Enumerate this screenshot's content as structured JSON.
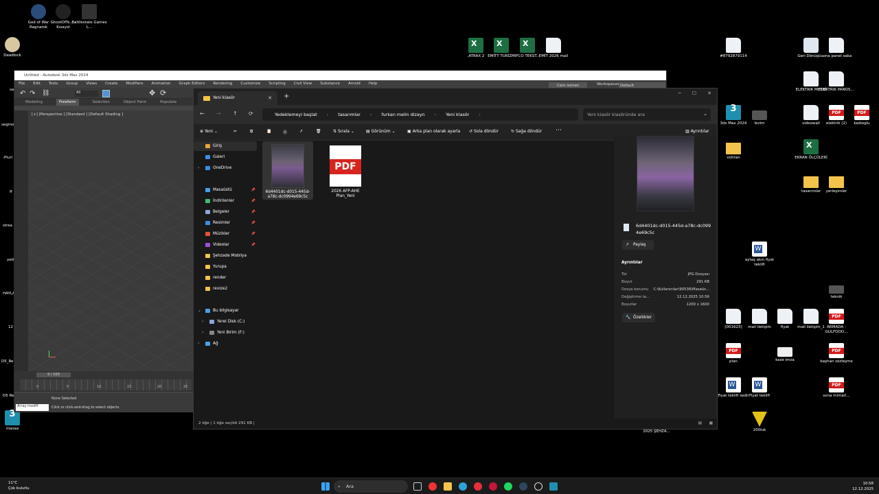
{
  "desktop": {
    "top_icons": [
      {
        "label": "God of War Ragnarok",
        "kind": "game"
      },
      {
        "label": "GhostOfTs... - Kısayol",
        "kind": "game"
      },
      {
        "label": "Battlestate Games L...",
        "kind": "game"
      },
      {
        "label": "Deadlock",
        "kind": "game"
      }
    ],
    "center_icons": [
      {
        "label": ",ATRAX 2",
        "kind": "xls"
      },
      {
        "label": "EMİTT TURİZM",
        "kind": "xls"
      },
      {
        "label": "IFCO TEKST...",
        "kind": "xls"
      },
      {
        "label": "EMİT 2026 mail",
        "kind": "doc"
      }
    ],
    "right_icons": [
      {
        "label": "#8792879114",
        "kind": "doc"
      },
      {
        "label": "Geri Dönüşü...",
        "kind": "recycle"
      },
      {
        "label": "sona panel saka",
        "kind": "doc"
      },
      {
        "label": "ELEKTRIK METNİ",
        "kind": "doc"
      },
      {
        "label": "ELEKTRIK PANOS...",
        "kind": "doc"
      },
      {
        "label": "3ds Max 2024",
        "kind": "max"
      },
      {
        "label": "lezim",
        "kind": "img"
      },
      {
        "label": "videowall",
        "kind": "doc"
      },
      {
        "label": "elektrik (2)",
        "kind": "pdf"
      },
      {
        "label": "kadıoglu",
        "kind": "pdf"
      },
      {
        "label": "voltran",
        "kind": "fold"
      },
      {
        "label": "EKRAN ÖLÇÜLERİ",
        "kind": "xls"
      },
      {
        "label": "tasarımlar",
        "kind": "fold"
      },
      {
        "label": "yerleşimler",
        "kind": "fold"
      },
      {
        "label": "aytaş akın fiyat teklifi",
        "kind": "wrd"
      },
      {
        "label": "teknik",
        "kind": "img"
      },
      {
        "label": "[001623]",
        "kind": "doc"
      },
      {
        "label": "mail iletişim",
        "kind": "doc"
      },
      {
        "label": "fiyat",
        "kind": "doc"
      },
      {
        "label": "mail iletişim_1",
        "kind": "doc"
      },
      {
        "label": "ARMADA - GULFOOD...",
        "kind": "pdf"
      },
      {
        "label": "plan",
        "kind": "pdf"
      },
      {
        "label": "kase imza",
        "kind": "img"
      },
      {
        "label": "başhan sözleşme",
        "kind": "pdf"
      },
      {
        "label": "Fiyat teklifi sedir",
        "kind": "wrd"
      },
      {
        "label": "Fiyat teklifi",
        "kind": "wrd"
      },
      {
        "label": "sona mimarl...",
        "kind": "pdf"
      },
      {
        "label": "200luk",
        "kind": "norton"
      },
      {
        "label": "2025 ŞEHZA...",
        "kind": "none"
      }
    ],
    "left_partial": [
      "sa",
      "segmo",
      "-Pluri",
      "ff",
      "strea",
      "yeti",
      "HAYLA",
      "12",
      "D5_Re",
      "D5 Re",
      "masaa"
    ]
  },
  "max3ds": {
    "title": "Untitled - Autodesk 3ds Max 2024",
    "menus": [
      "File",
      "Edit",
      "Tools",
      "Group",
      "Views",
      "Create",
      "Modifiers",
      "Animation",
      "Graph Editors",
      "Rendering",
      "Customize",
      "Scripting",
      "Civil View",
      "Substance",
      "Arnold",
      "Help"
    ],
    "user": "Cem isimen",
    "workspace_label": "Workspaces:",
    "workspace_value": "Default",
    "selection_dropdown": "All",
    "ribbon": [
      "Modeling",
      "Freeform",
      "Selection",
      "Object Paint",
      "Populate"
    ],
    "viewport_label": "[+] [Perspective ] [Standard ] [Default Shading ]",
    "frame": "0 / 100",
    "ticks": [
      "0",
      "5",
      "10",
      "15",
      "20",
      "25"
    ],
    "status1": "None Selected",
    "status2": "Click or click-and-drag to select objects",
    "maxscript": "Array modifi"
  },
  "explorer": {
    "tab_title": "Yeni klasör",
    "breadcrumbs": [
      "Yedeklemeyi başlat",
      "tasarımlar",
      "furkan melin dizayn",
      "Yeni klasör"
    ],
    "search_placeholder": "Yeni klasör klasöründe ara",
    "commands": {
      "new": "Yeni",
      "sort": "Sırala",
      "view": "Görünüm",
      "set_bg": "Arka plan olarak ayarla",
      "rotate_left": "Sola döndür",
      "rotate_right": "Sağa döndür",
      "details": "Ayrıntılar"
    },
    "nav": [
      {
        "label": "Giriş",
        "icon": "home-icon",
        "color": "#e8a33d",
        "selected": true,
        "pin": false,
        "chev": false
      },
      {
        "label": "Galeri",
        "icon": "gallery-icon",
        "color": "#3a8ee6",
        "pin": false,
        "chev": false
      },
      {
        "label": "OneDrive",
        "icon": "cloud-icon",
        "color": "#3a8ee6",
        "pin": false,
        "chev": true
      },
      {
        "label": "Masaüstü",
        "icon": "desktop-icon",
        "color": "#4aa0e6",
        "pin": true
      },
      {
        "label": "İndirilenler",
        "icon": "download-icon",
        "color": "#3fbf6f",
        "pin": true
      },
      {
        "label": "Belgeler",
        "icon": "documents-icon",
        "color": "#8aa8d8",
        "pin": true
      },
      {
        "label": "Resimler",
        "icon": "pictures-icon",
        "color": "#3a8ee6",
        "pin": true
      },
      {
        "label": "Müzikler",
        "icon": "music-icon",
        "color": "#e2513a",
        "pin": true
      },
      {
        "label": "Videolar",
        "icon": "videos-icon",
        "color": "#9b4fd8",
        "pin": true
      },
      {
        "label": "Şehzade Mobilya",
        "icon": "folder-icon",
        "color": "#f3c34c",
        "pin": false
      },
      {
        "label": "Yurupa",
        "icon": "folder-icon",
        "color": "#f3c34c",
        "pin": false
      },
      {
        "label": "render",
        "icon": "folder-icon",
        "color": "#f3c34c",
        "pin": false
      },
      {
        "label": "revize2",
        "icon": "folder-icon",
        "color": "#f3c34c",
        "pin": false
      },
      {
        "label": "Bu bilgisayar",
        "icon": "computer-icon",
        "color": "#4aa0e6",
        "pin": false,
        "chev": true,
        "expanded": true
      },
      {
        "label": "Yerel Disk (C:)",
        "icon": "disk-icon",
        "color": "#8aa8d8",
        "pin": false,
        "chev": true,
        "indent": true
      },
      {
        "label": "Yeni Birim (F:)",
        "icon": "disk-icon",
        "color": "#888",
        "pin": false,
        "chev": true,
        "indent": true
      },
      {
        "label": "Ağ",
        "icon": "network-icon",
        "color": "#4aa0e6",
        "pin": false,
        "chev": true
      }
    ],
    "files": [
      {
        "name": "6d4401dc-d015-445d-a78c-dc0994e69c5c",
        "type": "image",
        "selected": true
      },
      {
        "name": "2026 AFP-AHE Plan_Yeni",
        "type": "pdf",
        "selected": false
      }
    ],
    "pdf_badge": "PDF",
    "details_pane": {
      "title": "6d4401dc-d015-445d-a78c-dc0994e69c5c",
      "share": "Paylaş",
      "heading": "Ayrıntılar",
      "rows": [
        {
          "k": "Tür",
          "v": "JPG Dosyası"
        },
        {
          "k": "Boyut",
          "v": "291 KB"
        },
        {
          "k": "Dosya konumu",
          "v": "C:\\Kullanıcılar\\90536\\Masaüs..."
        },
        {
          "k": "Değiştirme ta...",
          "v": "12.12.2025 10:56"
        },
        {
          "k": "Boyutlar",
          "v": "1200 x 1600"
        }
      ],
      "properties": "Özellikler"
    },
    "status": "2 öğe  |  1 öğe seçildi  291 KB  |"
  },
  "taskbar": {
    "weather_temp": "11°C",
    "weather_desc": "Çok bulutlu",
    "search": "Ara",
    "time": "10:58",
    "date": "12.12.2025"
  }
}
